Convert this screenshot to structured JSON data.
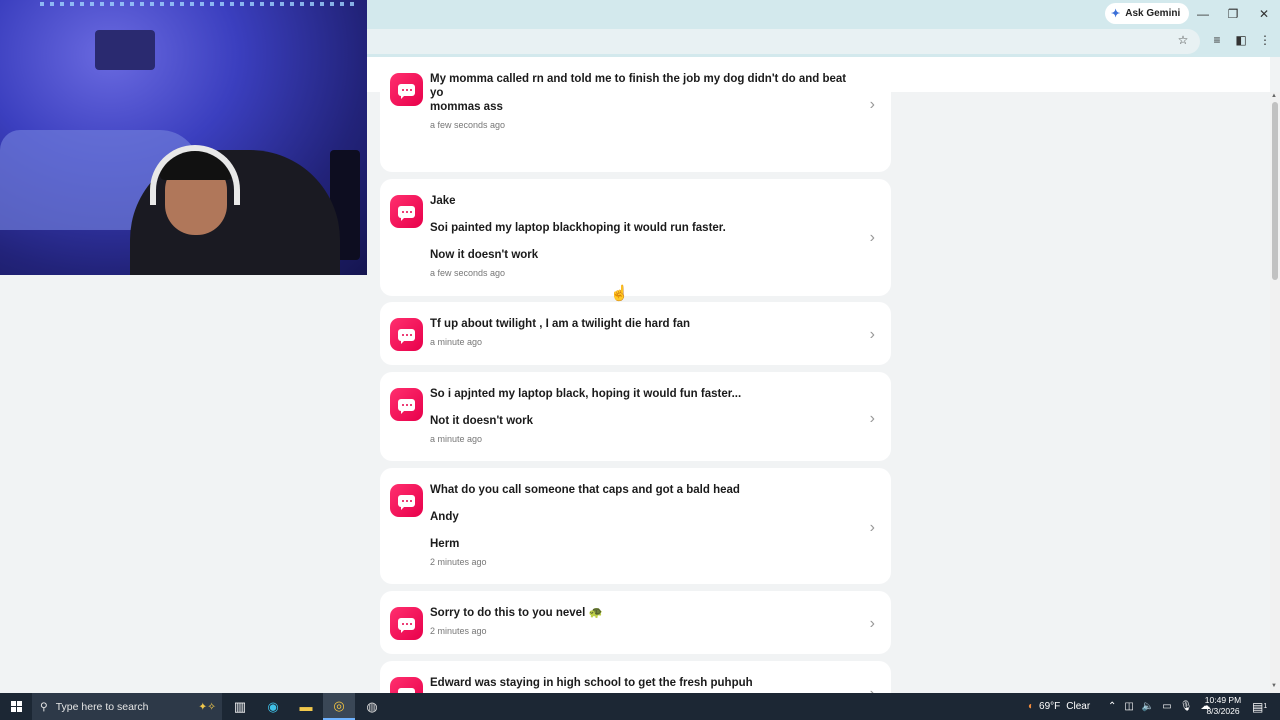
{
  "browser": {
    "ask_gemini_label": "Ask Gemini",
    "minimize_glyph": "—",
    "restore_glyph": "❐",
    "close_glyph": "✕"
  },
  "app_header": {
    "notification_count": "0"
  },
  "messages": [
    {
      "lines": [
        "My momma called rn and told me to finish the job my dog didn't do and beat yo",
        "mommas ass"
      ],
      "time": "a few seconds ago"
    },
    {
      "lines": [
        "Jake",
        "",
        "Soi painted my laptop blackhoping it would run faster.",
        "",
        "Now it doesn't work"
      ],
      "time": "a few seconds ago"
    },
    {
      "lines": [
        "Tf up about twilight , I am a twilight die hard fan"
      ],
      "time": "a minute ago"
    },
    {
      "lines": [
        "So i apjnted my laptop black, hoping it would fun faster...",
        "",
        "Not it doesn't work"
      ],
      "time": "a minute ago"
    },
    {
      "lines": [
        "What do you call someone that caps and got a bald head",
        "",
        " Andy",
        "",
        "Herm"
      ],
      "time": "2 minutes ago"
    },
    {
      "lines": [
        "Sorry to do this to you nevel 🐢"
      ],
      "time": "2 minutes ago"
    },
    {
      "lines": [
        "Edward was staying in high school to get the fresh puhpuh"
      ],
      "time": ""
    }
  ],
  "taskbar": {
    "search_placeholder": "Type here to search",
    "weather_temp": "69°F",
    "weather_desc": "Clear",
    "clock_time": "10:49 PM",
    "clock_date": "8/3/2026",
    "notification_count": "1"
  }
}
